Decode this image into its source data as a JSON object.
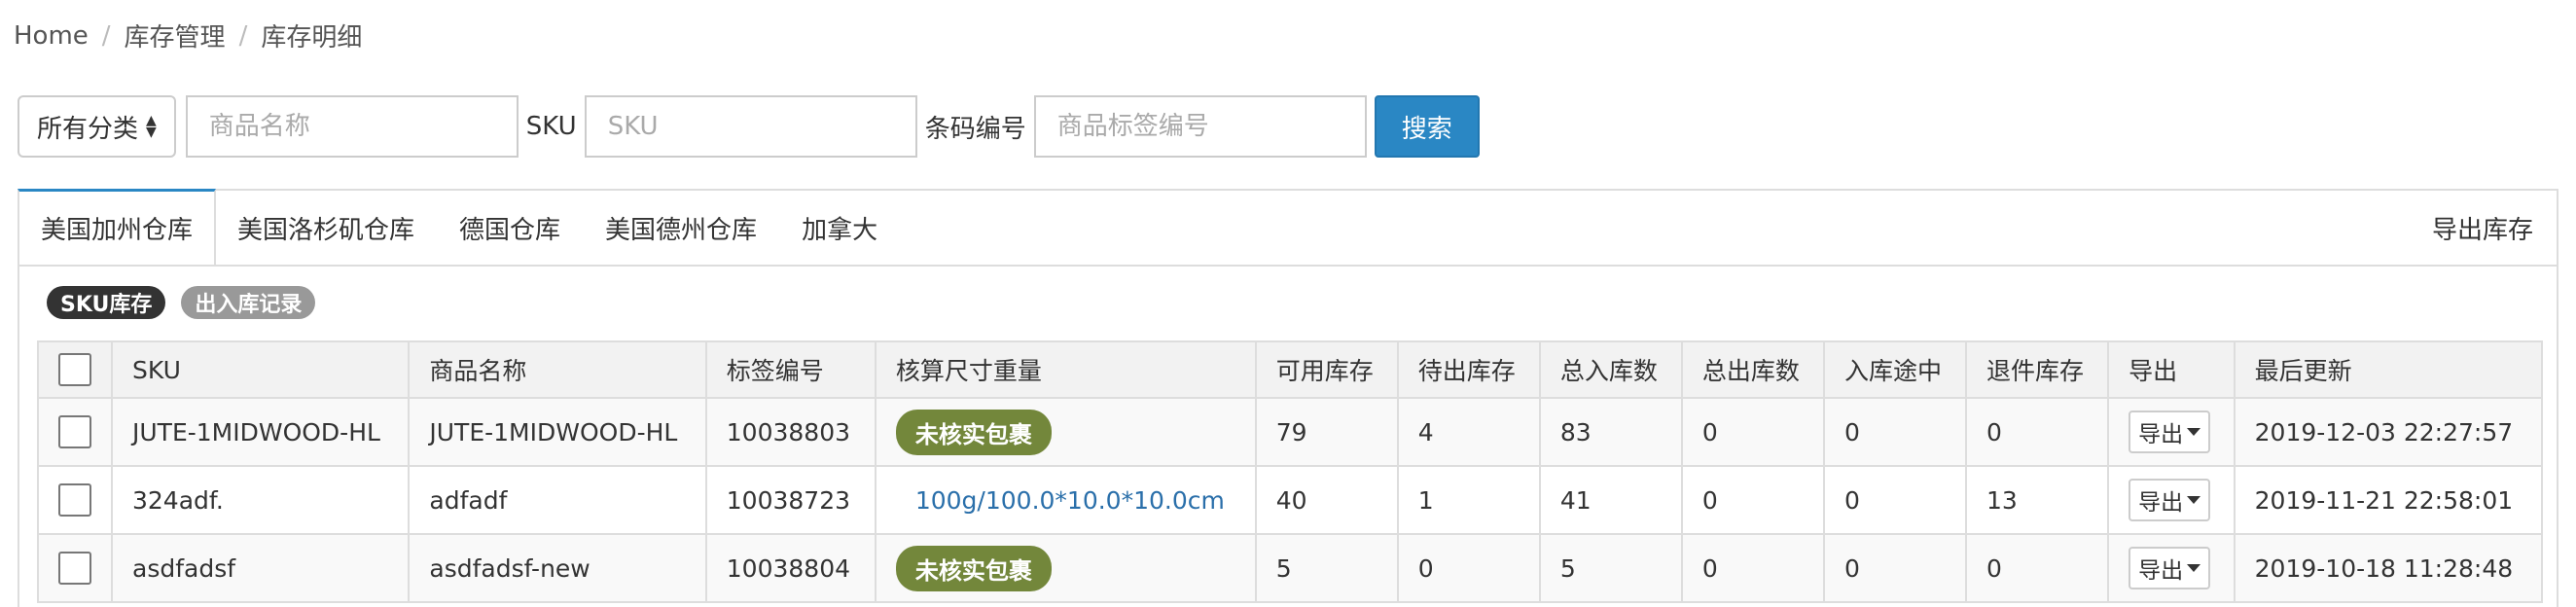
{
  "breadcrumb": [
    "Home",
    "库存管理",
    "库存明细"
  ],
  "search": {
    "category_label": "所有分类",
    "name_placeholder": "商品名称",
    "sku_label": "SKU",
    "sku_placeholder": "SKU",
    "barcode_label": "条码编号",
    "barcode_placeholder": "商品标签编号",
    "search_button": "搜索"
  },
  "tabs": [
    "美国加州仓库",
    "美国洛杉矶仓库",
    "德国仓库",
    "美国德州仓库",
    "加拿大"
  ],
  "export_inventory": "导出库存",
  "pills": [
    "SKU库存",
    "出入库记录"
  ],
  "table": {
    "headers": [
      "SKU",
      "商品名称",
      "标签编号",
      "核算尺寸重量",
      "可用库存",
      "待出库存",
      "总入库数",
      "总出库数",
      "入库途中",
      "退件库存",
      "导出",
      "最后更新"
    ],
    "export_button": "导出",
    "rows": [
      {
        "sku": "JUTE-1MIDWOOD-HL",
        "name": "JUTE-1MIDWOOD-HL",
        "label": "10038803",
        "dims": "未核实包裹",
        "dims_type": "tag",
        "available": "79",
        "pending": "4",
        "total_in": "83",
        "total_out": "0",
        "in_transit": "0",
        "returned": "0",
        "updated": "2019-12-03 22:27:57"
      },
      {
        "sku": "324adf.",
        "name": "adfadf",
        "label": "10038723",
        "dims": "100g/100.0*10.0*10.0cm",
        "dims_type": "link",
        "available": "40",
        "pending": "1",
        "total_in": "41",
        "total_out": "0",
        "in_transit": "0",
        "returned": "13",
        "updated": "2019-11-21 22:58:01"
      },
      {
        "sku": "asdfadsf",
        "name": "asdfadsf-new",
        "label": "10038804",
        "dims": "未核实包裹",
        "dims_type": "tag",
        "available": "5",
        "pending": "0",
        "total_in": "5",
        "total_out": "0",
        "in_transit": "0",
        "returned": "0",
        "updated": "2019-10-18 11:28:48"
      }
    ]
  }
}
